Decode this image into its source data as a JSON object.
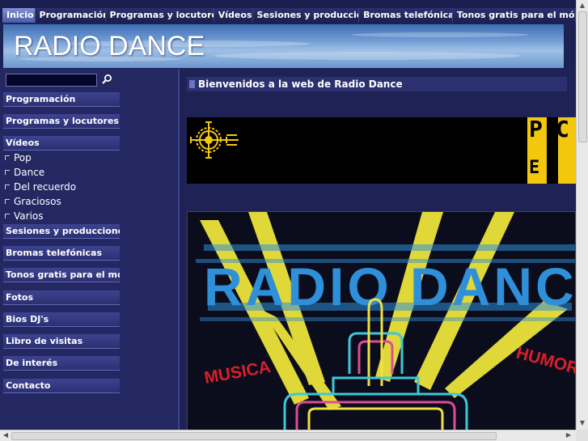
{
  "topnav": {
    "tabs": [
      {
        "label": "Inicio",
        "active": true
      },
      {
        "label": "Programación"
      },
      {
        "label": "Programas y locutores"
      },
      {
        "label": "Vídeos"
      },
      {
        "label": "Sesiones y producciones p"
      },
      {
        "label": "Bromas telefónicas"
      },
      {
        "label": "Tonos gratis para el móvil"
      }
    ]
  },
  "banner": {
    "title": "RADIO DANCE"
  },
  "search": {
    "placeholder": "",
    "icon": "search-icon"
  },
  "sidebar": {
    "programacion": "Programación",
    "programas": "Programas y locutores",
    "videos": "Vídeos",
    "sub": [
      "Pop",
      "Dance",
      "Del recuerdo",
      "Graciosos",
      "Varios"
    ],
    "sesiones": "Sesiones y producciones p",
    "bromas": "Bromas telefónicas",
    "tonos": "Tonos gratis para el móvil",
    "fotos": "Fotos",
    "bios": "Bios DJ's",
    "libro": "Libro de visitas",
    "interes": "De interés",
    "contacto": "Contacto"
  },
  "main": {
    "heading": "Bienvenidos a la web de Radio Dance",
    "pc_logo": [
      "P",
      "C",
      "E"
    ],
    "poster": {
      "title": "RADIO DANCE",
      "left_word": "MUSICA",
      "right_word": "HUMOR"
    }
  },
  "colors": {
    "background": "#1e2254",
    "accent_yellow": "#f2e23a",
    "poster_blue": "#2f8fd8",
    "poster_red": "#d8202a"
  }
}
